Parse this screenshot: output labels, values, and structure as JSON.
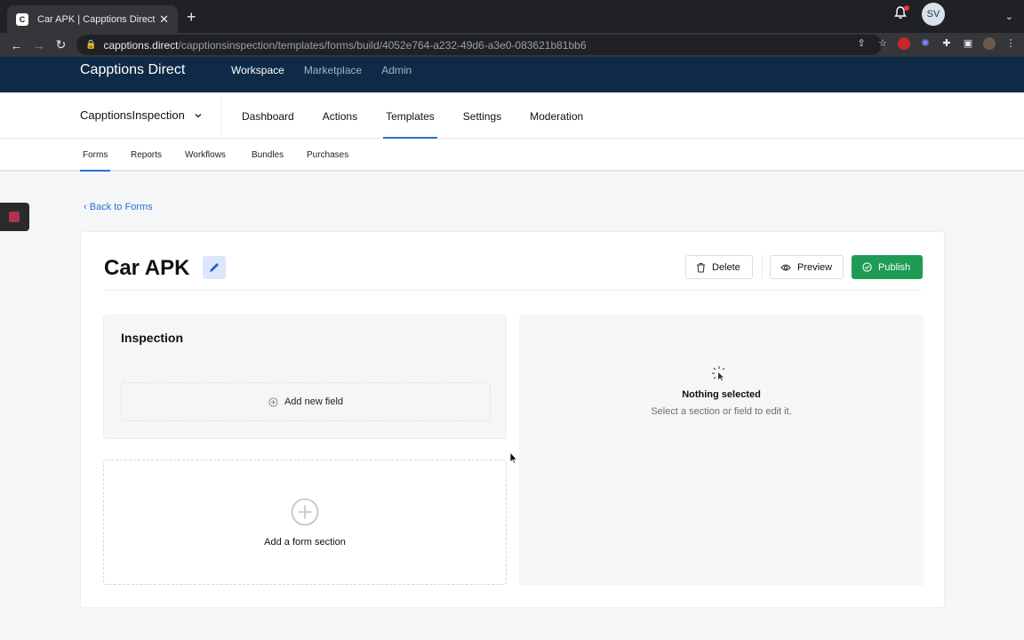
{
  "browser": {
    "tab_title": "Car APK | Capptions Direct",
    "tab_icon": "capptions-logo",
    "url_host": "capptions.direct",
    "url_path": "/capptionsinspection/templates/forms/build/4052e764-a232-49d6-a3e0-083621b81bb6"
  },
  "app": {
    "brand": "Capptions Direct",
    "top_nav": [
      {
        "label": "Workspace",
        "active": true
      },
      {
        "label": "Marketplace",
        "active": false
      },
      {
        "label": "Admin",
        "active": false
      }
    ],
    "avatar_initials": "SV",
    "notification_dot_color": "#e53935",
    "header_color": "#0e2a47"
  },
  "workspace": {
    "name": "CapptionsInspection"
  },
  "section_nav": [
    {
      "label": "Dashboard",
      "active": false
    },
    {
      "label": "Actions",
      "active": false
    },
    {
      "label": "Templates",
      "active": true
    },
    {
      "label": "Settings",
      "active": false
    },
    {
      "label": "Moderation",
      "active": false
    }
  ],
  "sub_nav": [
    {
      "label": "Forms",
      "active": true
    },
    {
      "label": "Reports",
      "active": false
    },
    {
      "label": "Workflows",
      "active": false
    },
    {
      "label": "Bundles",
      "active": false
    },
    {
      "label": "Purchases",
      "active": false
    }
  ],
  "back_link": "Back to Forms",
  "form": {
    "title": "Car APK",
    "buttons": {
      "delete": "Delete",
      "preview": "Preview",
      "publish": "Publish"
    },
    "publish_color": "#1e9b54",
    "section": {
      "title": "Inspection",
      "add_field": "Add new field"
    },
    "add_section": "Add a form section",
    "empty_panel": {
      "title": "Nothing selected",
      "subtitle": "Select a section or field to edit it."
    }
  },
  "accent_color": "#2a6fd6"
}
